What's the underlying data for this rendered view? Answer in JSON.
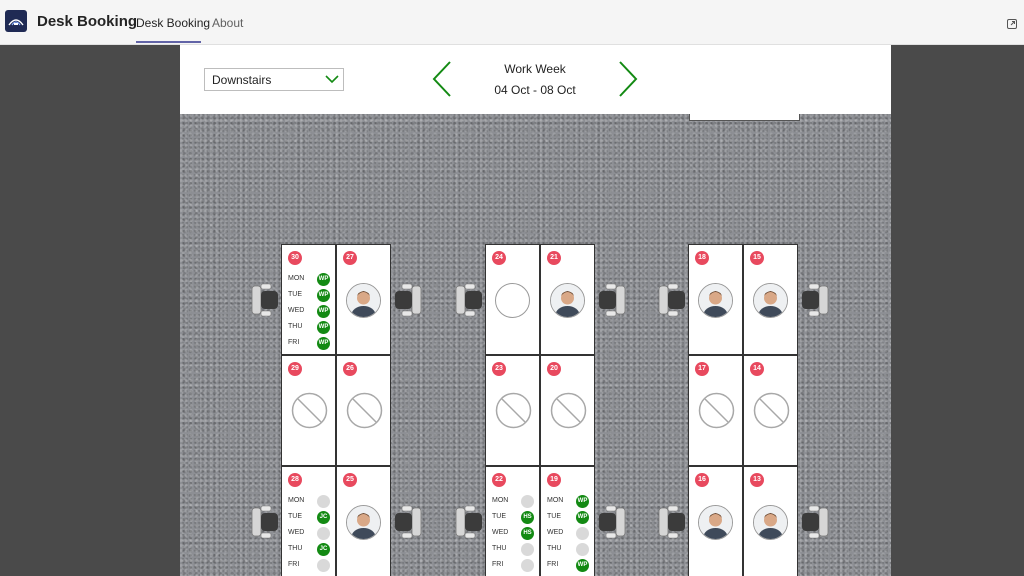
{
  "app": {
    "title": "Desk Booking",
    "tabs": [
      {
        "label": "Desk Booking",
        "active": true
      },
      {
        "label": "About",
        "active": false
      }
    ],
    "accent_color": "#6264a7"
  },
  "controls": {
    "floor_selected": "Downstairs",
    "week_label": "Work Week",
    "week_range": "04 Oct - 08 Oct",
    "nav_color": "#138a13"
  },
  "desks": [
    {
      "number": "30",
      "mode": "schedule",
      "schedule": [
        {
          "day": "MON",
          "initials": "WP"
        },
        {
          "day": "TUE",
          "initials": "WP"
        },
        {
          "day": "WED",
          "initials": "WP"
        },
        {
          "day": "THU",
          "initials": "WP"
        },
        {
          "day": "FRI",
          "initials": "WP"
        }
      ]
    },
    {
      "number": "27",
      "mode": "avatar"
    },
    {
      "number": "29",
      "mode": "unavailable"
    },
    {
      "number": "26",
      "mode": "unavailable"
    },
    {
      "number": "28",
      "mode": "schedule",
      "schedule": [
        {
          "day": "MON",
          "initials": ""
        },
        {
          "day": "TUE",
          "initials": "JC"
        },
        {
          "day": "WED",
          "initials": ""
        },
        {
          "day": "THU",
          "initials": "JC"
        },
        {
          "day": "FRI",
          "initials": ""
        }
      ]
    },
    {
      "number": "25",
      "mode": "avatar"
    },
    {
      "number": "24",
      "mode": "empty"
    },
    {
      "number": "21",
      "mode": "avatar"
    },
    {
      "number": "23",
      "mode": "unavailable"
    },
    {
      "number": "20",
      "mode": "unavailable"
    },
    {
      "number": "22",
      "mode": "schedule",
      "schedule": [
        {
          "day": "MON",
          "initials": ""
        },
        {
          "day": "TUE",
          "initials": "HS"
        },
        {
          "day": "WED",
          "initials": "HS"
        },
        {
          "day": "THU",
          "initials": ""
        },
        {
          "day": "FRI",
          "initials": ""
        }
      ]
    },
    {
      "number": "19",
      "mode": "schedule",
      "schedule": [
        {
          "day": "MON",
          "initials": "WP"
        },
        {
          "day": "TUE",
          "initials": "WP"
        },
        {
          "day": "WED",
          "initials": ""
        },
        {
          "day": "THU",
          "initials": ""
        },
        {
          "day": "FRI",
          "initials": "WP"
        }
      ]
    },
    {
      "number": "18",
      "mode": "avatar"
    },
    {
      "number": "15",
      "mode": "avatar"
    },
    {
      "number": "17",
      "mode": "unavailable"
    },
    {
      "number": "14",
      "mode": "unavailable"
    },
    {
      "number": "16",
      "mode": "avatar"
    },
    {
      "number": "13",
      "mode": "avatar"
    }
  ],
  "icons": {
    "logo": "desk-booking-logo-icon",
    "popout": "popout-icon",
    "dropdown": "chevron-down-icon",
    "prev": "chevron-left-icon",
    "next": "chevron-right-icon",
    "unavailable": "not-available-icon",
    "chair": "chair-icon",
    "avatar": "person-avatar-icon"
  },
  "colors": {
    "desk_badge": "#e8495e",
    "booked": "#138a13",
    "free_day": "#d9d9d9",
    "topbar": "#f5f5f5",
    "gutter": "#4a4a4a",
    "carpet": "#8d8f94"
  }
}
